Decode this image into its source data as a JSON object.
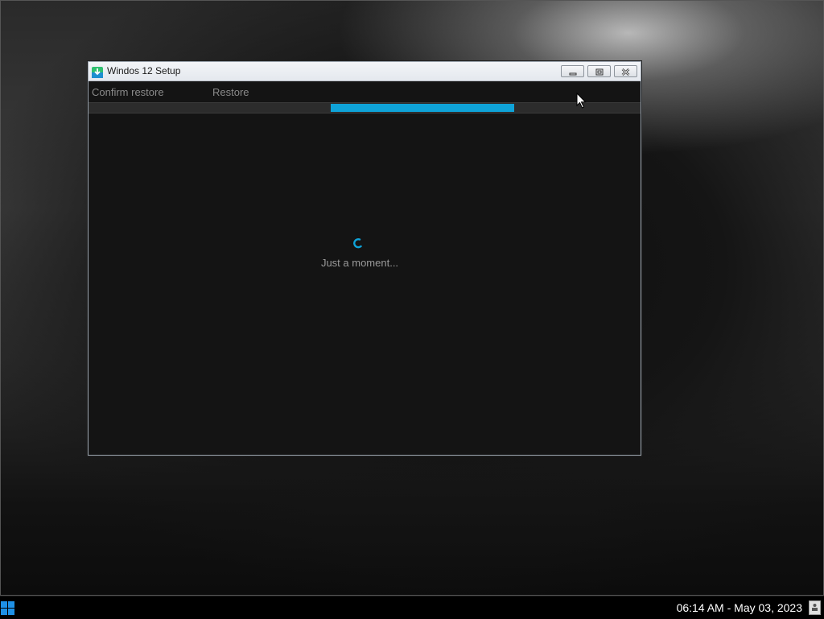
{
  "window": {
    "title": "Windos 12 Setup",
    "icon": "setup-download-icon",
    "controls": [
      "minimize-icon",
      "maximize-icon",
      "close-icon"
    ]
  },
  "steps": {
    "items": [
      {
        "label": "Confirm restore"
      },
      {
        "label": "Restore"
      }
    ]
  },
  "progress": {
    "label": "indeterminate",
    "color": "#0fa3d8"
  },
  "content": {
    "spinner_icon": "loading-spinner-icon",
    "status_text": "Just a moment..."
  },
  "taskbar": {
    "start_icon": "windows-start-icon",
    "clock": "06:14 AM - May 03, 2023",
    "tray_icon": "notification-icon"
  },
  "colors": {
    "accent": "#0fa3d8",
    "window_bg": "#141414",
    "taskbar_bg": "#000000"
  }
}
